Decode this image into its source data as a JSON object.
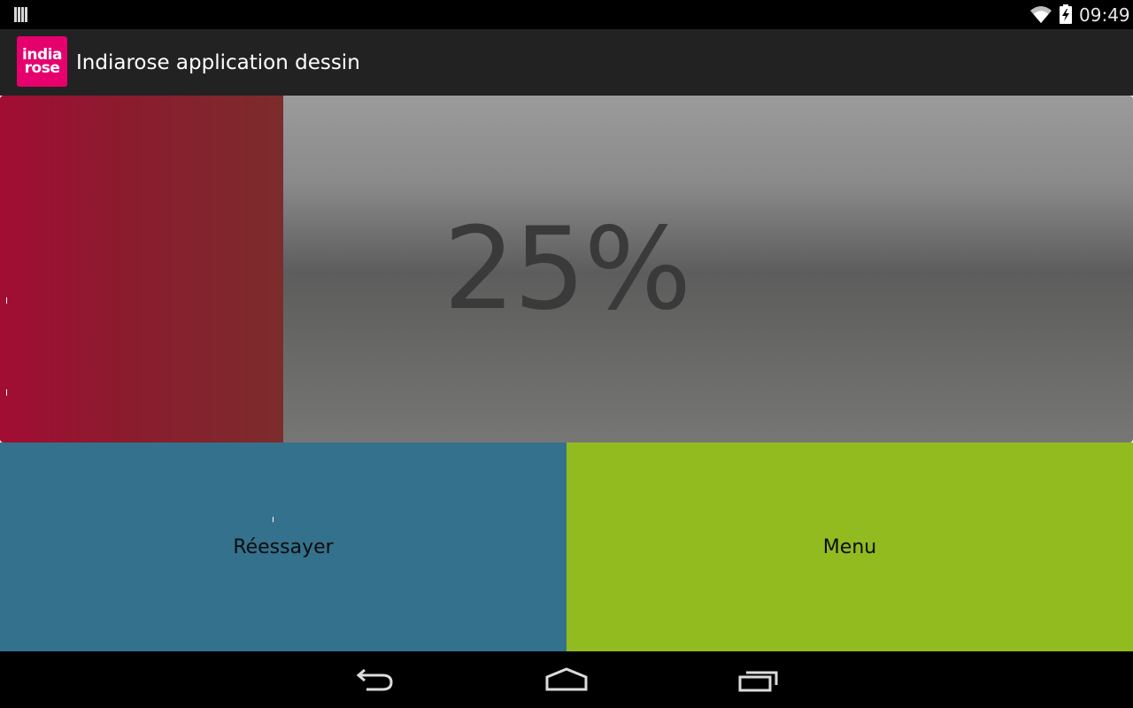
{
  "status_bar": {
    "time": "09:49",
    "icons": [
      "notification-bars-icon",
      "wifi-icon",
      "battery-charging-icon"
    ]
  },
  "action_bar": {
    "logo_line1": "india",
    "logo_line2": "rose",
    "title": "Indiarose application dessin"
  },
  "progress": {
    "value_fraction": 0.25,
    "label": "25%"
  },
  "buttons": {
    "retry_label": "Réessayer",
    "menu_label": "Menu"
  },
  "nav_bar": {
    "icons": [
      "back-icon",
      "home-icon",
      "recent-apps-icon"
    ]
  },
  "colors": {
    "logo": "#e6006e",
    "action_bar": "#222222",
    "progress_fill": "#a20d34",
    "progress_track": "#6e6f6d",
    "retry_button": "#34718c",
    "menu_button": "#92bb20"
  }
}
